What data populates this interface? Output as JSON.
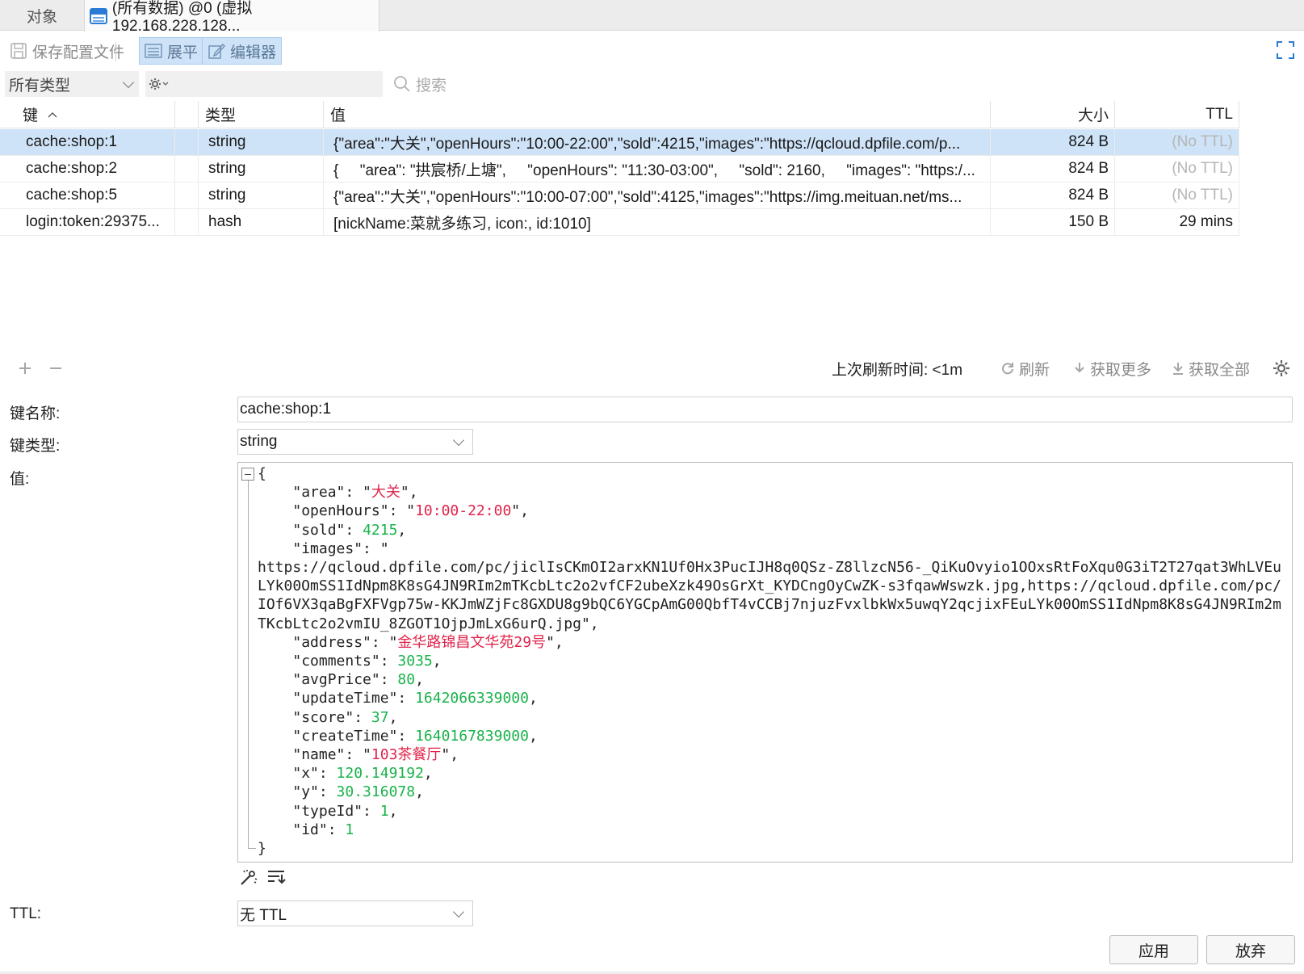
{
  "tabs": {
    "objects": "对象",
    "active": "(所有数据) @0 (虚拟192.168.228.128..."
  },
  "toolbar": {
    "save_profile": "保存配置文件",
    "flatten": "展平",
    "editor": "编辑器"
  },
  "filter": {
    "type_select": "所有类型",
    "search_placeholder": "搜索"
  },
  "table": {
    "columns": [
      "键",
      "类型",
      "值",
      "大小",
      "TTL"
    ],
    "rows": [
      {
        "key": "cache:shop:1",
        "type": "string",
        "value": "{\"area\":\"大关\",\"openHours\":\"10:00-22:00\",\"sold\":4215,\"images\":\"https://qcloud.dpfile.com/p...",
        "size": "824 B",
        "ttl": "(No TTL)"
      },
      {
        "key": "cache:shop:2",
        "type": "string",
        "value": "{     \"area\": \"拱宸桥/上塘\",     \"openHours\": \"11:30-03:00\",     \"sold\": 2160,     \"images\": \"https:/...",
        "size": "824 B",
        "ttl": "(No TTL)"
      },
      {
        "key": "cache:shop:5",
        "type": "string",
        "value": "{\"area\":\"大关\",\"openHours\":\"10:00-07:00\",\"sold\":4125,\"images\":\"https://img.meituan.net/ms...",
        "size": "824 B",
        "ttl": "(No TTL)"
      },
      {
        "key": "login:token:29375...",
        "type": "hash",
        "value": "[nickName:菜就多练习, icon:, id:1010]",
        "size": "150 B",
        "ttl": "29 mins"
      }
    ]
  },
  "grid_footer": {
    "last_refresh": "上次刷新时间: <1m",
    "refresh": "刷新",
    "fetch_more": "获取更多",
    "fetch_all": "获取全部"
  },
  "detail": {
    "key_name_label": "键名称:",
    "key_name": "cache:shop:1",
    "key_type_label": "键类型:",
    "key_type": "string",
    "value_label": "值:",
    "ttl_label": "TTL:",
    "ttl_value": "无 TTL",
    "apply": "应用",
    "discard": "放弃"
  },
  "json_value": {
    "area": "大关",
    "openHours": "10:00-22:00",
    "sold": "4215",
    "images": "https://qcloud.dpfile.com/pc/jiclIsCKmOI2arxKN1Uf0Hx3PucIJH8q0QSz-Z8llzcN56-_QiKuOvyio1OOxsRtFoXqu0G3iT2T27qat3WhLVEuLYk00OmSS1IdNpm8K8sG4JN9RIm2mTKcbLtc2o2vfCF2ubeXzk49OsGrXt_KYDCngOyCwZK-s3fqawWswzk.jpg,https://qcloud.dpfile.com/pc/IOf6VX3qaBgFXFVgp75w-KKJmWZjFc8GXDU8g9bQC6YGCpAmG00QbfT4vCCBj7njuzFvxlbkWx5uwqY2qcjixFEuLYk00OmSS1IdNpm8K8sG4JN9RIm2mTKcbLtc2o2vmIU_8ZGOT1OjpJmLxG6urQ.jpg",
    "address": "金华路锦昌文华苑29号",
    "comments": "3035",
    "avgPrice": "80",
    "updateTime": "1642066339000",
    "score": "37",
    "createTime": "1640167839000",
    "name": "103茶餐厅",
    "x": "120.149192",
    "y": "30.316078",
    "typeId": "1",
    "id": "1"
  },
  "colors": {
    "selection": "#cfe3f8",
    "string_value": "#e0244a",
    "number_value": "#19b24b"
  },
  "icons": [
    "table-icon",
    "save-icon",
    "flatten-icon",
    "editor-icon",
    "expand-icon",
    "gear-icon",
    "search-icon",
    "sort-asc-icon",
    "add-icon",
    "remove-icon",
    "refresh-icon",
    "download-icon",
    "format-icon",
    "wrap-icon"
  ]
}
